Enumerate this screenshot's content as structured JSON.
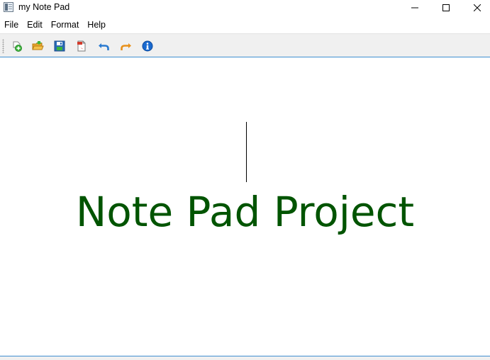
{
  "window": {
    "title": "my Note Pad",
    "icon": "notepad-app-icon"
  },
  "window_controls": {
    "minimize_icon": "minimize-icon",
    "maximize_icon": "maximize-icon",
    "close_icon": "close-icon"
  },
  "menubar": {
    "items": [
      {
        "label": "File"
      },
      {
        "label": "Edit"
      },
      {
        "label": "Format"
      },
      {
        "label": "Help"
      }
    ]
  },
  "toolbar": {
    "buttons": [
      {
        "icon": "new-file-icon"
      },
      {
        "icon": "open-folder-icon"
      },
      {
        "icon": "save-icon"
      },
      {
        "icon": "export-pdf-icon"
      },
      {
        "icon": "undo-icon"
      },
      {
        "icon": "redo-icon"
      },
      {
        "icon": "info-icon"
      }
    ]
  },
  "editor": {
    "content": "Note Pad Project",
    "text_color": "#005400"
  },
  "colors": {
    "accent_line": "#3f8fd0",
    "toolbar_bg": "#f0f0f0"
  }
}
